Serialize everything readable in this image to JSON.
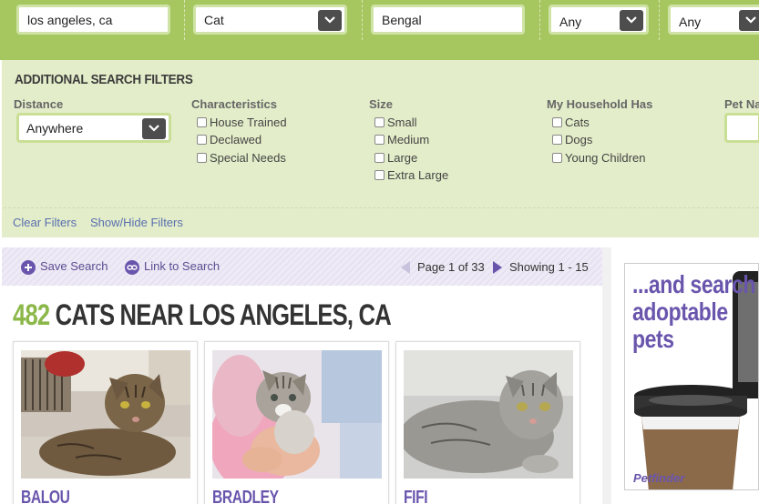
{
  "search_bar": {
    "location_value": "los angeles, ca",
    "animal_value": "Cat",
    "breed_value": "Bengal",
    "age_value": "Any",
    "gender_value": "Any"
  },
  "filters": {
    "title": "ADDITIONAL SEARCH FILTERS",
    "distance": {
      "label": "Distance",
      "value": "Anywhere"
    },
    "characteristics": {
      "label": "Characteristics",
      "options": [
        "House Trained",
        "Declawed",
        "Special Needs"
      ]
    },
    "size": {
      "label": "Size",
      "options": [
        "Small",
        "Medium",
        "Large",
        "Extra Large"
      ]
    },
    "household": {
      "label": "My Household Has",
      "options": [
        "Cats",
        "Dogs",
        "Young Children"
      ]
    },
    "pet_name": {
      "label": "Pet Na"
    },
    "clear_label": "Clear Filters",
    "toggle_label": "Show/Hide Filters"
  },
  "results_bar": {
    "save_search": "Save Search",
    "link_to_search": "Link to Search",
    "page_info": "Page 1 of 33",
    "showing": "Showing 1 - 15"
  },
  "results": {
    "count": "482",
    "heading": "CATS NEAR LOS ANGELES, CA",
    "pets": [
      {
        "name": "BALOU"
      },
      {
        "name": "BRADLEY"
      },
      {
        "name": "FIFI"
      }
    ]
  },
  "ad": {
    "line1": "...and search",
    "line2": "adoptable",
    "line3": "pets",
    "logo": "Petfinder"
  },
  "colors": {
    "topbar": "#a6c75f",
    "filter_panel": "#e3edc9",
    "accent_purple": "#6a55ad",
    "count_green": "#8cb84a"
  }
}
